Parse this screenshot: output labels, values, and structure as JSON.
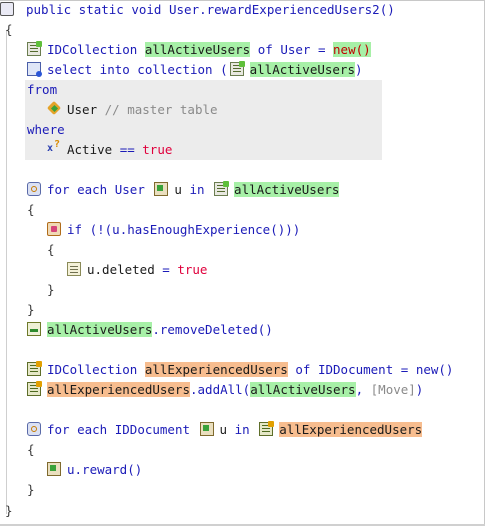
{
  "method": {
    "header": "public static void User.rewardExperiencedUsers2()"
  },
  "braces": {
    "open": "{",
    "close": "}"
  },
  "decl1": {
    "type": "IDCollection",
    "name": "allActiveUsers",
    "of": "of",
    "elem_type": "User",
    "eq": "=",
    "new_kw": "new()"
  },
  "select": {
    "prefix": "select into collection (",
    "target": "allActiveUsers",
    "close": ")"
  },
  "from": {
    "kw": "from",
    "table": "User",
    "comment": "// master table"
  },
  "where": {
    "kw": "where",
    "field": "Active",
    "op": "==",
    "value": "true"
  },
  "loop1": {
    "for_each": "for each",
    "type": "User",
    "var": "u",
    "in_kw": "in",
    "coll": "allActiveUsers"
  },
  "if1": {
    "if_kw": "if",
    "cond": "(!(u.hasEnoughExperience()))"
  },
  "assign1": {
    "target": "u.deleted",
    "eq": "=",
    "value": "true"
  },
  "call1": {
    "target": "allActiveUsers",
    "rest": ".removeDeleted()"
  },
  "decl2": {
    "type": "IDCollection",
    "name": "allExperiencedUsers",
    "of": "of",
    "elem_type": "IDDocument",
    "eq": "=",
    "new_kw": "new()"
  },
  "call2": {
    "target": "allExperiencedUsers",
    "method": ".addAll(",
    "arg": "allActiveUsers",
    "sep": ",",
    "option": "[Move]",
    "close": ")"
  },
  "loop2": {
    "for_each": "for each",
    "type": "IDDocument",
    "var": "u",
    "in_kw": "in",
    "coll": "allExperiencedUsers"
  },
  "call3": {
    "stmt": "u.reward()"
  },
  "icons": {
    "method": "method-icon",
    "collection": "collection-icon",
    "select": "select-icon",
    "table": "table-icon",
    "where": "filter-icon",
    "loop": "loop-icon",
    "if": "if-icon",
    "assign": "assign-icon",
    "var": "variable-icon",
    "call": "call-icon",
    "doc": "document-collection-icon"
  },
  "colors": {
    "keyword": "#1b1bb8",
    "green_highlight": "#a7f0a7",
    "orange_highlight": "#f7bd8f",
    "value_red": "#e0003c",
    "query_bg": "#ececec"
  }
}
